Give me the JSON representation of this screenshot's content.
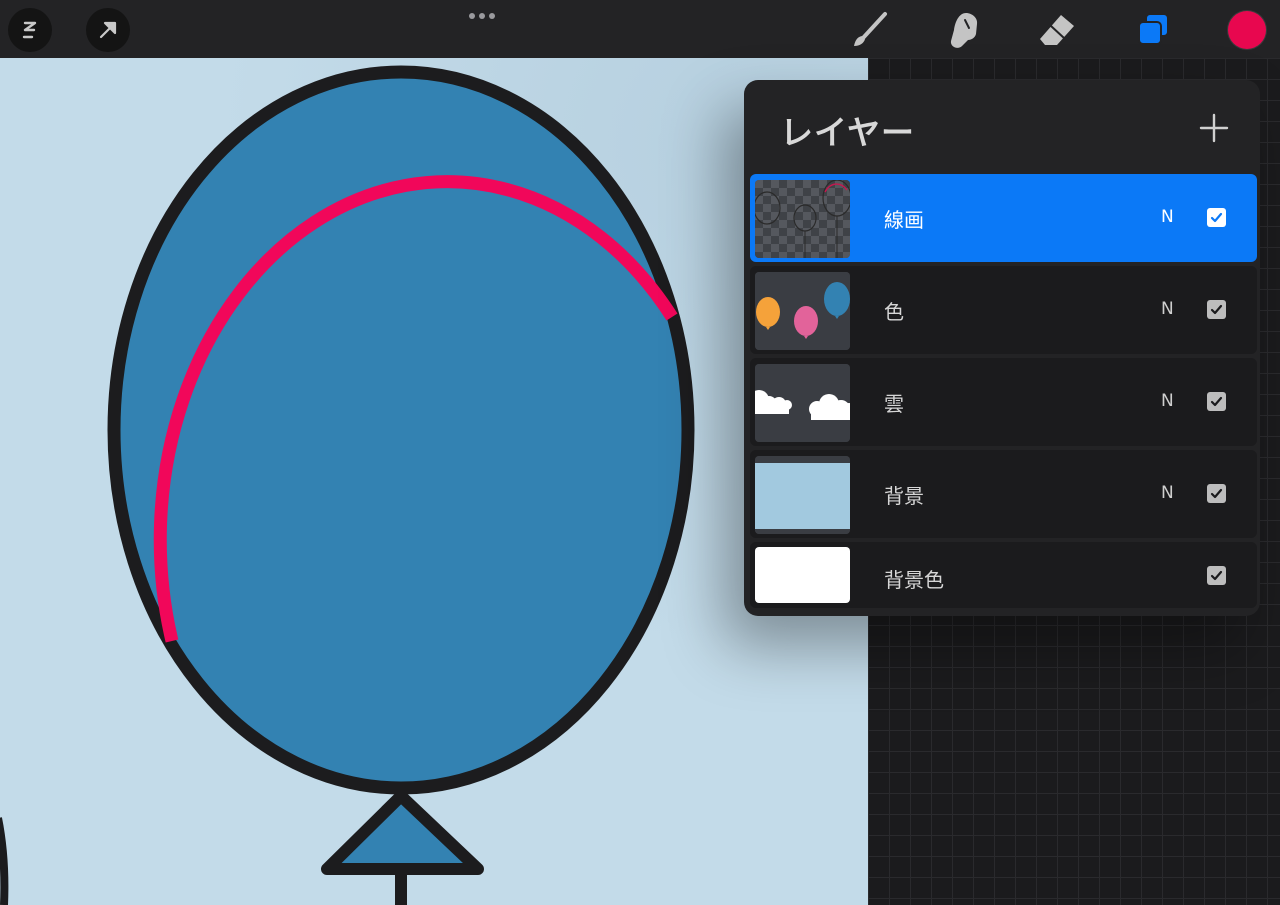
{
  "toolbar": {
    "gallery_icon": "procreate-s-icon",
    "actions_icon": "arrow-cursor-icon",
    "more_icon": "ellipsis-icon",
    "brush_icon": "brush-icon",
    "smudge_icon": "smudge-finger-icon",
    "eraser_icon": "eraser-icon",
    "layers_icon": "layers-icon",
    "current_color": "#e8074f"
  },
  "layers_panel": {
    "title": "レイヤー",
    "add_icon": "plus-icon",
    "layers": [
      {
        "name": "線画",
        "blend": "N",
        "visible": true,
        "selected": true
      },
      {
        "name": "色",
        "blend": "N",
        "visible": true,
        "selected": false
      },
      {
        "name": "雲",
        "blend": "N",
        "visible": true,
        "selected": false
      },
      {
        "name": "背景",
        "blend": "N",
        "visible": true,
        "selected": false
      },
      {
        "name": "背景色",
        "blend": "",
        "visible": true,
        "selected": false
      }
    ]
  },
  "colors": {
    "accent_blue": "#0b79f7",
    "balloon_fill": "#3382b2",
    "canvas_background": "#c3dbe9",
    "stroke_highlight": "#f1075a",
    "stroke_dark": "#1c1c1e"
  }
}
